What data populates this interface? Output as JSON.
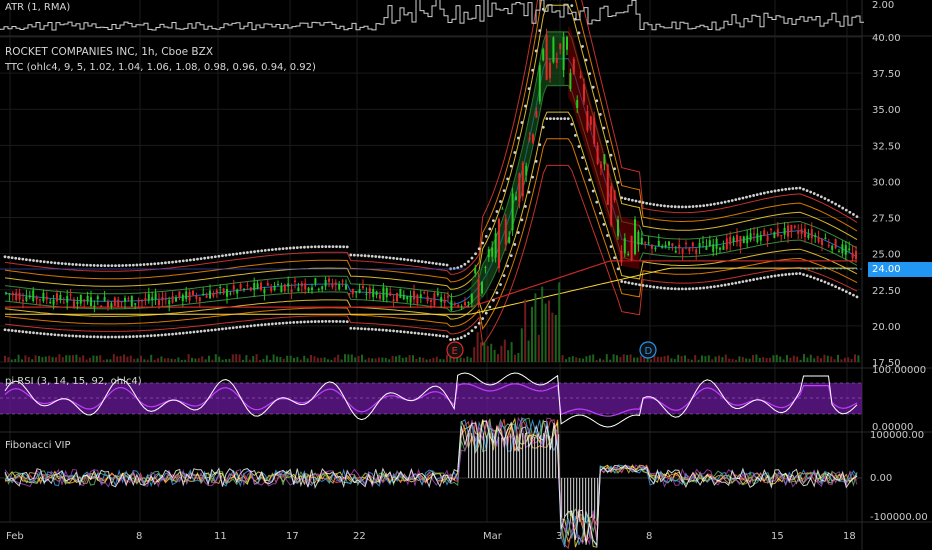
{
  "colors": {
    "background": "#000000",
    "grid": "#1b1b1b",
    "text": "#c9c9c9",
    "up": "#26c926",
    "down": "#e02a2a",
    "last_price_tag": "#2196f3",
    "rsi_band": "#6a1b9a",
    "rsi_line": "#ffffff",
    "rsi_signal": "#c13cff"
  },
  "panes": {
    "atr": {
      "label": "ATR (1, RMA)",
      "y_ticks": [
        "2.00"
      ]
    },
    "main": {
      "symbol_line": "ROCKET COMPANIES INC, 1h, Cboe BZX",
      "indicator_line": "TTC (ohlc4, 9, 5, 1.02, 1.04, 1.06, 1.08, 0.98, 0.96, 0.94, 0.92)",
      "y_ticks": [
        "40.00",
        "37.50",
        "35.00",
        "32.50",
        "30.00",
        "27.50",
        "25.00",
        "22.50",
        "20.00",
        "17.50"
      ],
      "last_price": "24.00",
      "event_markers": [
        {
          "letter": "E",
          "label_color": "#e02a2a"
        },
        {
          "letter": "D",
          "label_color": "#2196f3"
        }
      ]
    },
    "rsi": {
      "label": "pi RSI (3, 14, 15, 92, ohlc4)",
      "y_ticks": [
        "100.00000",
        "0.00000"
      ]
    },
    "fib": {
      "label": "Fibonacci VIP",
      "y_ticks": [
        "100000.00",
        "0.00",
        "-100000.00"
      ]
    }
  },
  "x_axis": {
    "labels": [
      "Feb",
      "8",
      "11",
      "17",
      "22",
      "Mar",
      "3",
      "8",
      "15",
      "18"
    ]
  },
  "chart_data": {
    "type": "line",
    "title": "ROCKET COMPANIES INC, 1h, Cboe BZX",
    "xlabel": "",
    "ylabel": "",
    "categories": [
      "Feb",
      "8",
      "11",
      "17",
      "22",
      "Mar",
      "3",
      "8",
      "15",
      "18"
    ],
    "ylim": [
      17.5,
      40.0
    ],
    "series": [
      {
        "values": [
          22.5,
          22.2,
          21.8,
          22.0,
          21.4,
          24.5,
          38.5,
          26.0,
          25.8,
          24.0
        ]
      }
    ]
  }
}
